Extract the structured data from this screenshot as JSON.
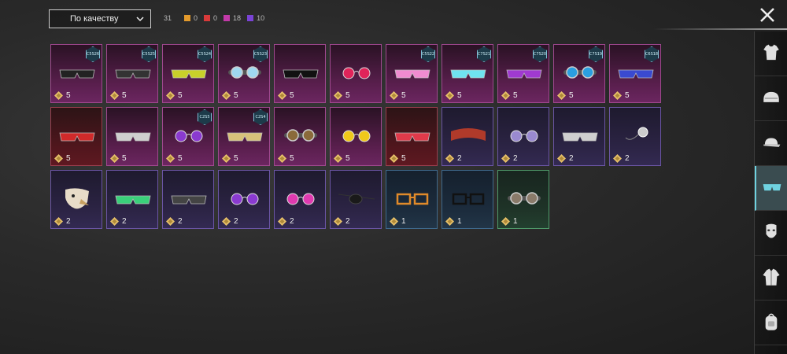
{
  "sort": {
    "label": "По качеству"
  },
  "counts": {
    "total": "31",
    "items": [
      {
        "color": "#e39a2c",
        "value": "0"
      },
      {
        "color": "#d83a3a",
        "value": "0"
      },
      {
        "color": "#c23aa8",
        "value": "18"
      },
      {
        "color": "#7a43d6",
        "value": "10"
      }
    ]
  },
  "rows": [
    [
      {
        "rarity": "pink",
        "code": "C5S26",
        "qty": "5",
        "icon": "sunglasses-icon",
        "color": "#222"
      },
      {
        "rarity": "pink",
        "code": "C5S25",
        "qty": "5",
        "icon": "sunglasses-icon",
        "color": "#333"
      },
      {
        "rarity": "pink",
        "code": "C5S24",
        "qty": "5",
        "icon": "sunglasses-icon",
        "color": "#c8d12a"
      },
      {
        "rarity": "pink",
        "code": "C5S23",
        "qty": "5",
        "icon": "goggles-icon",
        "color": "#9fd8f0"
      },
      {
        "rarity": "pink",
        "code": "",
        "qty": "5",
        "icon": "pixel-glasses-icon",
        "color": "#111"
      },
      {
        "rarity": "pink",
        "code": "",
        "qty": "5",
        "icon": "round-glasses-icon",
        "color": "#e0245a"
      },
      {
        "rarity": "pink",
        "code": "C5S22",
        "qty": "5",
        "icon": "visor-icon",
        "color": "#f08bd0"
      },
      {
        "rarity": "pink",
        "code": "C7S21",
        "qty": "5",
        "icon": "sunglasses-icon",
        "color": "#6fe3f0"
      },
      {
        "rarity": "pink",
        "code": "C7S20",
        "qty": "5",
        "icon": "sunglasses-icon",
        "color": "#a03ad0"
      },
      {
        "rarity": "pink",
        "code": "C7S19",
        "qty": "5",
        "icon": "goggles-icon",
        "color": "#2a9fe0"
      },
      {
        "rarity": "pink",
        "code": "C6S18",
        "qty": "5",
        "icon": "visor-icon",
        "color": "#3a4ad0"
      }
    ],
    [
      {
        "rarity": "red",
        "code": "",
        "qty": "5",
        "icon": "3d-glasses-icon",
        "color": "#d02a2a"
      },
      {
        "rarity": "pink",
        "code": "",
        "qty": "5",
        "icon": "visor-icon",
        "color": "#cfcfcf"
      },
      {
        "rarity": "pink",
        "code": "C2S5",
        "qty": "5",
        "icon": "round-glasses-icon",
        "color": "#8a3ad0"
      },
      {
        "rarity": "pink",
        "code": "C2S4",
        "qty": "5",
        "icon": "sunglasses-icon",
        "color": "#d8c27a"
      },
      {
        "rarity": "pink",
        "code": "",
        "qty": "5",
        "icon": "steampunk-goggles-icon",
        "color": "#8a6a3a"
      },
      {
        "rarity": "pink",
        "code": "",
        "qty": "5",
        "icon": "round-glasses-icon",
        "color": "#f0c81a"
      },
      {
        "rarity": "red",
        "code": "",
        "qty": "5",
        "icon": "sunglasses-icon",
        "color": "#e03a4a"
      },
      {
        "rarity": "purple",
        "code": "",
        "qty": "2",
        "icon": "headband-icon",
        "color": "#b03a2a"
      },
      {
        "rarity": "purple",
        "code": "",
        "qty": "2",
        "icon": "round-glasses-icon",
        "color": "#9a8ad0"
      },
      {
        "rarity": "purple",
        "code": "",
        "qty": "2",
        "icon": "visor-icon",
        "color": "#cfcfcf"
      },
      {
        "rarity": "purple",
        "code": "",
        "qty": "2",
        "icon": "monocle-icon",
        "color": "#cfcfcf"
      }
    ],
    [
      {
        "rarity": "purple",
        "code": "",
        "qty": "2",
        "icon": "eagle-mask-icon",
        "color": "#e8dcc8"
      },
      {
        "rarity": "purple",
        "code": "",
        "qty": "2",
        "icon": "visor-icon",
        "color": "#3ad07a"
      },
      {
        "rarity": "purple",
        "code": "",
        "qty": "2",
        "icon": "sunglasses-icon",
        "color": "#444"
      },
      {
        "rarity": "purple",
        "code": "",
        "qty": "2",
        "icon": "aviator-glasses-icon",
        "color": "#8a3ad0"
      },
      {
        "rarity": "purple",
        "code": "",
        "qty": "2",
        "icon": "aviator-glasses-icon",
        "color": "#e03ab0"
      },
      {
        "rarity": "purple",
        "code": "",
        "qty": "2",
        "icon": "eyepatch-icon",
        "color": "#1a1a1a"
      },
      {
        "rarity": "blue",
        "code": "",
        "qty": "1",
        "icon": "square-glasses-icon",
        "color": "#e08a2a"
      },
      {
        "rarity": "blue",
        "code": "",
        "qty": "1",
        "icon": "square-glasses-icon",
        "color": "#111"
      },
      {
        "rarity": "green",
        "code": "",
        "qty": "1",
        "icon": "steampunk-goggles-icon",
        "color": "#8a7a6a"
      }
    ]
  ],
  "sidebar": [
    {
      "icon": "shirt-icon",
      "active": false
    },
    {
      "icon": "helmet-icon",
      "active": false
    },
    {
      "icon": "cap-icon",
      "active": false
    },
    {
      "icon": "glasses-icon",
      "active": true
    },
    {
      "icon": "mask-icon",
      "active": false
    },
    {
      "icon": "jacket-icon",
      "active": false
    },
    {
      "icon": "backpack-icon",
      "active": false
    }
  ]
}
